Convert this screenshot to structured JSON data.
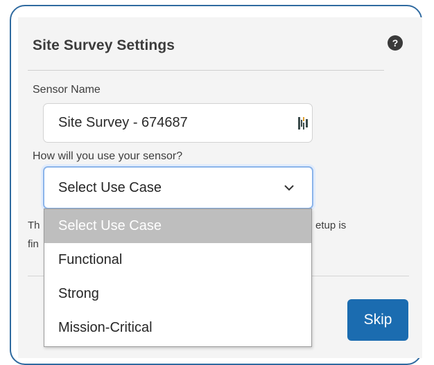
{
  "dialog": {
    "title": "Site Survey Settings",
    "help_icon": "question-circle-icon",
    "help_glyph": "?"
  },
  "sensor_name": {
    "label": "Sensor Name",
    "value": "Site Survey - 674687",
    "icon": "barcode-icon"
  },
  "use_case": {
    "label": "How will you use your sensor?",
    "selected": "Select Use Case",
    "icon": "chevron-down-icon",
    "options": [
      "Select Use Case",
      "Functional",
      "Strong",
      "Mission-Critical"
    ]
  },
  "background_text": {
    "left_line1": "Th",
    "left_line2": "fin",
    "right_line1": "etup is"
  },
  "actions": {
    "skip_label": "Skip"
  },
  "colors": {
    "frame_border": "#2f6aa0",
    "primary_button": "#1b6cb0",
    "focus_ring": "#8bb4ea",
    "selected_option_bg": "#bebebe"
  }
}
